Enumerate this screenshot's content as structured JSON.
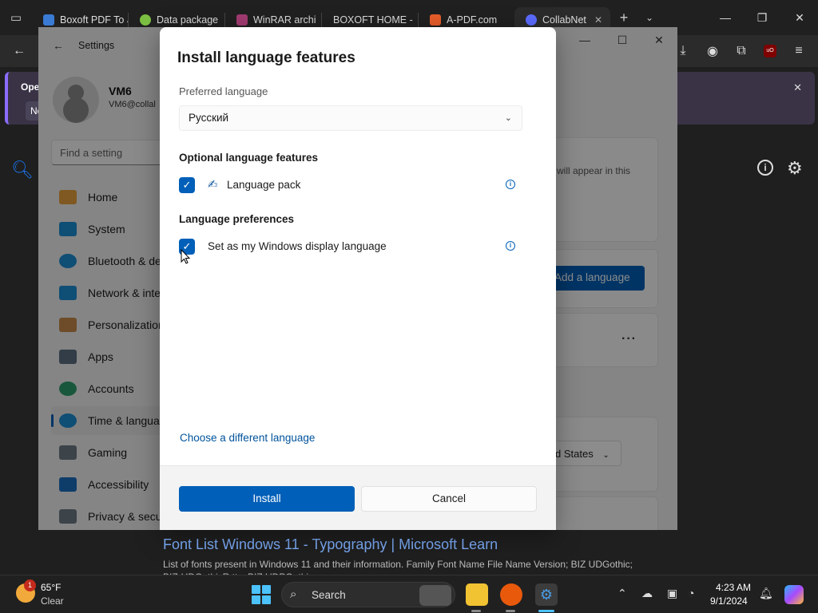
{
  "browser": {
    "tabs": [
      {
        "label": "Boxoft PDF To JPG",
        "icon_color": "#3a7bd5"
      },
      {
        "label": "Data package",
        "icon_color": "#7bc043"
      },
      {
        "label": "WinRAR archi",
        "icon_color": "#a23b72"
      },
      {
        "label": "BOXOFT HOME -",
        "icon_color": "#2b2b2b"
      },
      {
        "label": "A-PDF.com",
        "icon_color": "#e85d2a"
      },
      {
        "label": "CollabNet",
        "icon_color": "#5b6cff"
      }
    ],
    "notice": {
      "title": "Oper",
      "button": "No"
    }
  },
  "background_page": {
    "result_title": "Font List Windows 11 - Typography | Microsoft Learn",
    "result_snippet": "List of fonts present in Windows 11 and their information. Family Font Name File Name Version; BIZ UDGothic; BIZ-UDGothicR.ttc; BIZ UDPGothic"
  },
  "settings": {
    "title": "Settings",
    "user": {
      "name": "VM6",
      "email": "VM6@collal"
    },
    "find_placeholder": "Find a setting",
    "nav": [
      {
        "label": "Home",
        "icon": "home-icon",
        "color": "#e8a33d"
      },
      {
        "label": "System",
        "icon": "system-icon",
        "color": "#1c8fd6"
      },
      {
        "label": "Bluetooth & de",
        "icon": "bluetooth-icon",
        "color": "#1c8fd6"
      },
      {
        "label": "Network & inte",
        "icon": "network-icon",
        "color": "#1c8fd6"
      },
      {
        "label": "Personalization",
        "icon": "brush-icon",
        "color": "#c98a4b"
      },
      {
        "label": "Apps",
        "icon": "apps-icon",
        "color": "#5c6f82"
      },
      {
        "label": "Accounts",
        "icon": "accounts-icon",
        "color": "#2f9e6e"
      },
      {
        "label": "Time & langua",
        "icon": "globe-icon",
        "color": "#1c8fd6"
      },
      {
        "label": "Gaming",
        "icon": "gaming-icon",
        "color": "#6d7a86"
      },
      {
        "label": "Accessibility",
        "icon": "accessibility-icon",
        "color": "#1c6fc2"
      },
      {
        "label": "Privacy & secu",
        "icon": "shield-icon",
        "color": "#6d7a86"
      }
    ],
    "card_text": "will appear in this",
    "add_language": "Add a language",
    "region_value": "d States"
  },
  "dialog": {
    "title": "Install language features",
    "preferred_label": "Preferred language",
    "preferred_value": "Русский",
    "optional_heading": "Optional language features",
    "language_pack": "Language pack",
    "preferences_heading": "Language preferences",
    "display_language": "Set as my Windows display language",
    "choose_link": "Choose a different language",
    "install": "Install",
    "cancel": "Cancel"
  },
  "taskbar": {
    "weather_badge": "1",
    "temperature": "65°F",
    "condition": "Clear",
    "search": "Search",
    "time": "4:23 AM",
    "date": "9/1/2024"
  }
}
